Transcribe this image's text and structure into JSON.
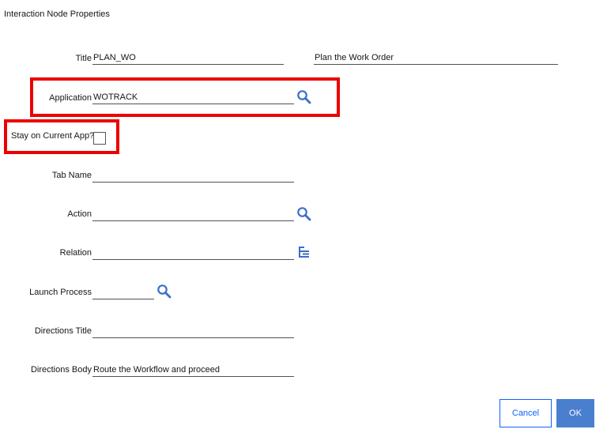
{
  "dialog": {
    "title": "Interaction Node Properties"
  },
  "fields": {
    "title": {
      "label": "Title",
      "value": "PLAN_WO",
      "description": "Plan the Work Order"
    },
    "application": {
      "label": "Application",
      "value": "WOTRACK"
    },
    "stay_on_current_app": {
      "label": "Stay on Current App?",
      "checked": false
    },
    "tab_name": {
      "label": "Tab Name",
      "value": ""
    },
    "action": {
      "label": "Action",
      "value": ""
    },
    "relation": {
      "label": "Relation",
      "value": ""
    },
    "launch_process": {
      "label": "Launch Process",
      "value": ""
    },
    "directions_title": {
      "label": "Directions Title",
      "value": ""
    },
    "directions_body": {
      "label": "Directions Body",
      "value": "Route the Workflow and proceed"
    }
  },
  "buttons": {
    "cancel": "Cancel",
    "ok": "OK"
  },
  "icons": {
    "lookup": "magnifier-icon",
    "relation": "hierarchy-tree-icon"
  },
  "colors": {
    "highlight": "#ec0000",
    "accent": "#0f62fe",
    "ok_bg": "#4a7fcf",
    "icon": "#3b6ec7"
  }
}
